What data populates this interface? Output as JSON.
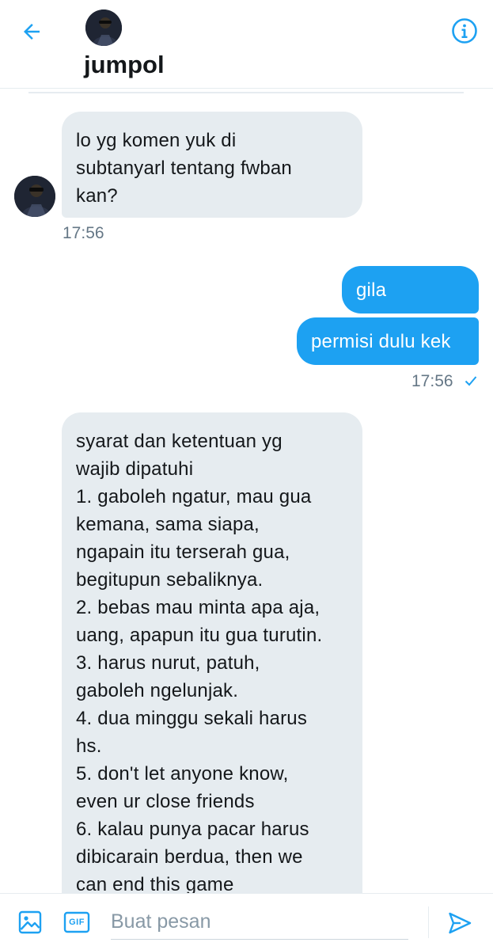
{
  "header": {
    "name": "jumpol",
    "back_icon": "arrow-left-icon",
    "info_icon": "info-icon",
    "accent": "#1da1f2"
  },
  "messages": [
    {
      "direction": "incoming",
      "lines": [
        "lo yg komen yuk di",
        "subtanyarl tentang fwban",
        "kan?"
      ]
    },
    {
      "time": "17:56"
    },
    {
      "direction": "outgoing",
      "lines": [
        "gila"
      ]
    },
    {
      "direction": "outgoing",
      "lines": [
        "permisi dulu kek"
      ]
    },
    {
      "time": "17:56",
      "read_icon": "check-icon"
    },
    {
      "direction": "incoming",
      "lines": [
        "syarat dan ketentuan yg",
        "wajib dipatuhi",
        "1. gaboleh ngatur, mau gua",
        "kemana, sama siapa,",
        "ngapain itu terserah gua,",
        "begitupun sebaliknya.",
        "2. bebas mau minta apa aja,",
        "uang, apapun itu gua turutin.",
        "3. harus nurut, patuh,",
        "gaboleh ngelunjak.",
        "4. dua minggu sekali harus",
        "hs.",
        "5. don't let anyone know,",
        "even ur close friends",
        "6. kalau punya pacar harus",
        "dibicarain berdua, then we",
        "can end this game"
      ]
    }
  ],
  "composer": {
    "placeholder": "Buat pesan",
    "media_icon": "image-icon",
    "gif_label": "GIF",
    "send_icon": "send-icon"
  }
}
